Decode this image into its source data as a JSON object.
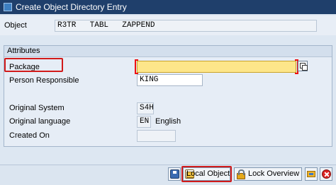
{
  "window": {
    "title": "Create Object Directory Entry"
  },
  "object": {
    "label": "Object",
    "pgmid": "R3TR",
    "type": "TABL",
    "name": "ZAPPEND"
  },
  "attributes": {
    "group_title": "Attributes",
    "package": {
      "label": "Package",
      "value": ""
    },
    "person_responsible": {
      "label": "Person Responsible",
      "value": "KING"
    },
    "original_system": {
      "label": "Original System",
      "value": "S4H"
    },
    "original_language": {
      "label": "Original language",
      "code": "EN",
      "text": "English"
    },
    "created_on": {
      "label": "Created On",
      "value": ""
    }
  },
  "footer": {
    "buttons": [
      {
        "label": "",
        "icon": "save-icon"
      },
      {
        "label": "Local Object",
        "icon": "local-object-icon"
      },
      {
        "label": "Lock Overview",
        "icon": "lock-icon"
      },
      {
        "label": "",
        "icon": "folder-icon"
      },
      {
        "label": "",
        "icon": "cancel-icon"
      }
    ]
  },
  "colors": {
    "highlight": "#d11a1a",
    "required_field": "#fde68a",
    "titlebar": "#1f3f6b"
  }
}
